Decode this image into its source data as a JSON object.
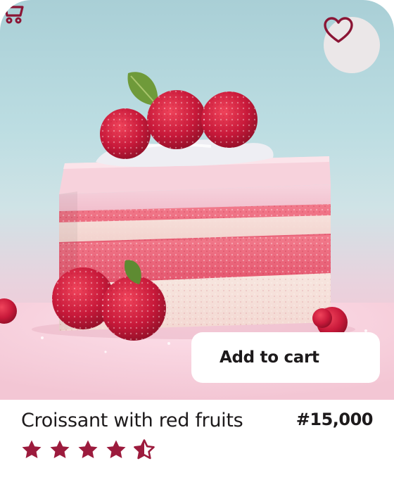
{
  "product": {
    "name": "Croissant with red fruits",
    "price": "#15,000",
    "rating": 4.5,
    "rating_max": 5,
    "image_alt": "raspberry-layer-cake-photo"
  },
  "actions": {
    "add_to_cart_label": "Add to cart"
  },
  "colors": {
    "accent": "#8b1535",
    "star": "#9c1b3d",
    "fav_bg": "#ebe7e8",
    "text": "#1d1a1b"
  },
  "icons": {
    "favorite": "heart-icon",
    "cart": "cart-icon",
    "rating": "star-icon"
  }
}
